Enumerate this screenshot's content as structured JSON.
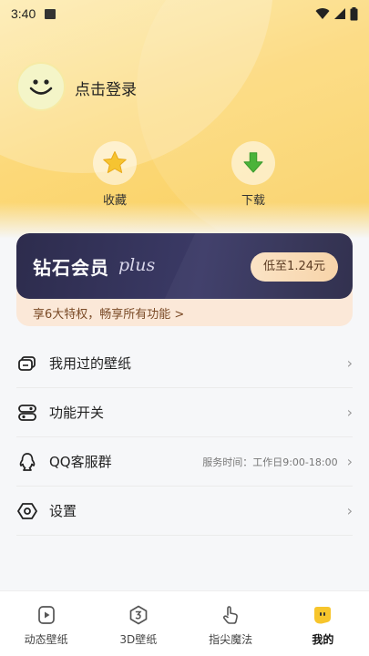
{
  "status_bar": {
    "time": "3:40"
  },
  "profile": {
    "login_text": "点击登录"
  },
  "quick_actions": [
    {
      "label": "收藏",
      "icon": "star-icon"
    },
    {
      "label": "下载",
      "icon": "download-icon"
    }
  ],
  "vip": {
    "title": "钻石会员",
    "plus_text": "plus",
    "price_button": "低至1.24元",
    "subtitle": "享6大特权，畅享所有功能 >"
  },
  "menu": [
    {
      "label": "我用过的壁纸",
      "icon": "wallpaper-history-icon",
      "note": ""
    },
    {
      "label": "功能开关",
      "icon": "toggle-icon",
      "note": ""
    },
    {
      "label": "QQ客服群",
      "icon": "qq-icon",
      "note": "服务时间：工作日9:00-18:00"
    },
    {
      "label": "设置",
      "icon": "settings-icon",
      "note": ""
    }
  ],
  "tabs": [
    {
      "label": "动态壁纸",
      "icon": "play-icon",
      "active": false
    },
    {
      "label": "3D壁纸",
      "icon": "3d-icon",
      "active": false
    },
    {
      "label": "指尖魔法",
      "icon": "finger-icon",
      "active": false
    },
    {
      "label": "我的",
      "icon": "mine-icon",
      "active": true
    }
  ],
  "colors": {
    "accent": "#f9cf5e",
    "vip_bg": "#2d2c4d",
    "vip_price": "#f7d4a9"
  }
}
